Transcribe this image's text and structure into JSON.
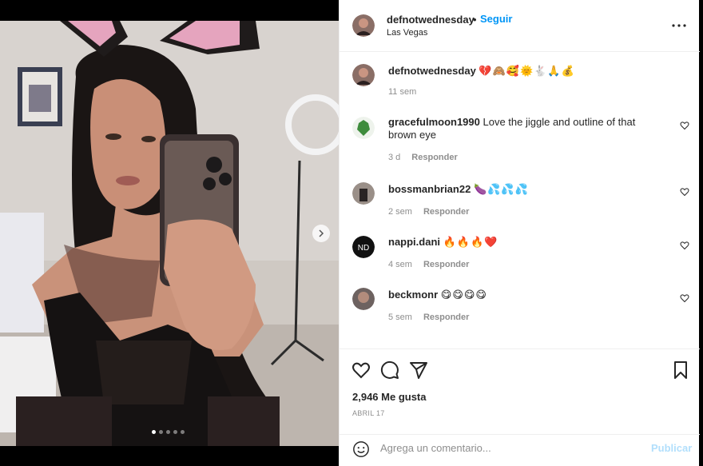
{
  "post": {
    "username": "defnotwednesday",
    "separator": "•",
    "follow_label": "Seguir",
    "location": "Las Vegas",
    "caption_emojis": "💔🙈🥰🌞🐇🙏💰",
    "caption_time": "11 sem",
    "likes": "2,946 Me gusta",
    "date": "ABRIL 17",
    "image_dots": 5,
    "active_dot": 0
  },
  "comments": [
    {
      "user": "gracefulmoon1990",
      "text": "Love the jiggle and outline of that brown eye",
      "time": "3 d",
      "reply": "Responder"
    },
    {
      "user": "bossmanbrian22",
      "text": "🍆💦💦💦",
      "time": "2 sem",
      "reply": "Responder"
    },
    {
      "user": "nappi.dani",
      "text": "🔥🔥🔥❤️",
      "time": "4 sem",
      "reply": "Responder"
    },
    {
      "user": "beckmonr",
      "text": "😋😋😋😋",
      "time": "5 sem",
      "reply": "Responder"
    }
  ],
  "composer": {
    "placeholder": "Agrega un comentario...",
    "post_label": "Publicar"
  },
  "colors": {
    "accent": "#0095f6",
    "text": "#262626",
    "muted": "#8e8e8e",
    "post_disabled": "#b2dffc"
  },
  "icons": [
    "heart-icon",
    "comment-icon",
    "share-icon",
    "bookmark-icon",
    "more-options-icon",
    "emoji-icon",
    "chevron-right-icon"
  ]
}
